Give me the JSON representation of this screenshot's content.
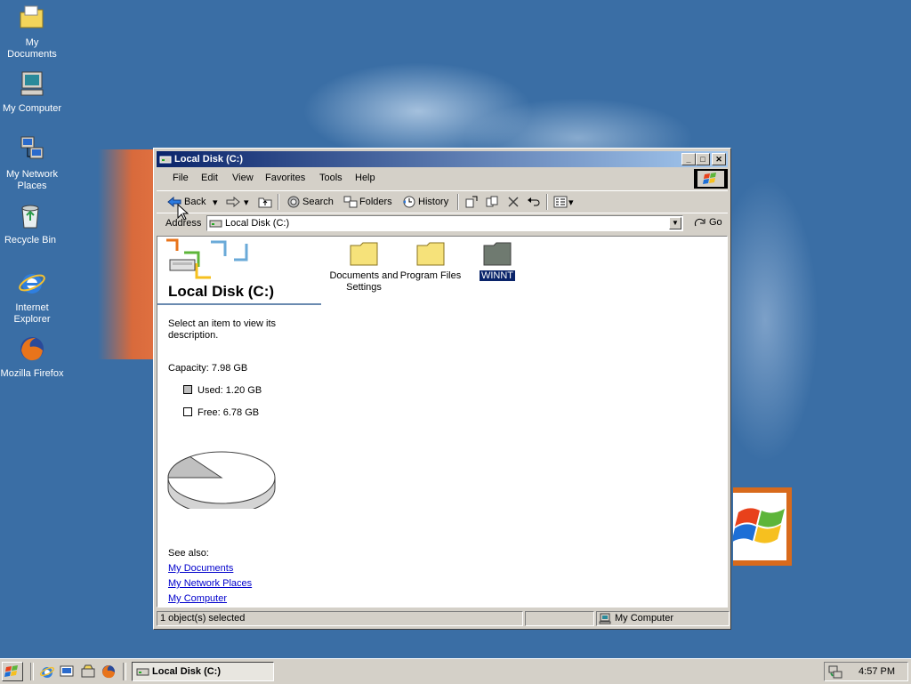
{
  "desktop": {
    "icons": [
      {
        "label": "My Documents"
      },
      {
        "label": "My Computer"
      },
      {
        "label": "My Network Places"
      },
      {
        "label": "Recycle Bin"
      },
      {
        "label": "Internet Explorer"
      },
      {
        "label": "Mozilla Firefox"
      }
    ]
  },
  "window": {
    "title": "Local Disk (C:)",
    "menu": [
      "File",
      "Edit",
      "View",
      "Favorites",
      "Tools",
      "Help"
    ],
    "toolbar": {
      "back_label": "Back",
      "search_label": "Search",
      "folders_label": "Folders",
      "history_label": "History"
    },
    "address": {
      "label": "Address",
      "value": "Local Disk (C:)",
      "go_label": "Go"
    },
    "info_pane": {
      "title": "Local Disk (C:)",
      "description": "Select an item to view its description.",
      "capacity": "Capacity: 7.98 GB",
      "used": "Used: 1.20 GB",
      "free": "Free: 6.78 GB",
      "used_gb": 1.2,
      "free_gb": 6.78,
      "see_also_label": "See also:",
      "links": [
        "My Documents",
        "My Network Places",
        "My Computer"
      ]
    },
    "folders": [
      {
        "name": "Documents and Settings",
        "selected": false
      },
      {
        "name": "Program Files",
        "selected": false
      },
      {
        "name": "WINNT",
        "selected": true
      }
    ],
    "status": {
      "selection": "1 object(s) selected",
      "zone": "My Computer"
    }
  },
  "taskbar": {
    "task_label": "Local Disk (C:)",
    "clock": "4:57 PM"
  },
  "colors": {
    "desktop": "#3a6ea5",
    "titlebar_start": "#0a246a",
    "titlebar_end": "#a6caf0",
    "selection": "#0a246a"
  }
}
